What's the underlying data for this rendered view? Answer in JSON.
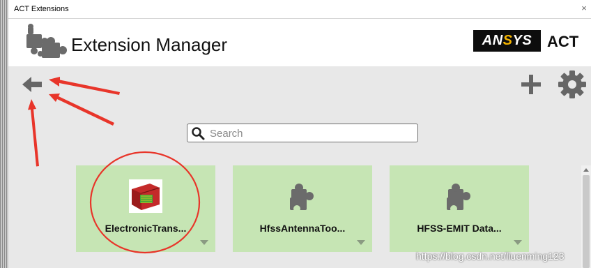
{
  "window": {
    "title": "ACT Extensions",
    "close_glyph": "×"
  },
  "header": {
    "app_icon": "puzzle-pieces-icon",
    "title": "Extension Manager",
    "logo": {
      "brand_pre": "AN",
      "brand_mid": "S",
      "brand_post": "YS",
      "product": "ACT"
    }
  },
  "toolbar": {
    "back_icon": "arrow-left-icon",
    "add_icon": "plus-icon",
    "settings_icon": "gear-icon"
  },
  "search": {
    "placeholder": "Search",
    "value": ""
  },
  "extensions": [
    {
      "label": "ElectronicTrans...",
      "icon": "electronic-transformer-icon"
    },
    {
      "label": "HfssAntennaToo...",
      "icon": "puzzle-piece-icon"
    },
    {
      "label": "HFSS-EMIT Data...",
      "icon": "puzzle-piece-icon"
    }
  ],
  "watermark": "https://blog.csdn.net/liuenming123",
  "colors": {
    "tile_bg": "#c6e5b4",
    "icon_gray": "#6b6b6b",
    "annotation_red": "#e8352a",
    "logo_yellow": "#f4b400"
  }
}
